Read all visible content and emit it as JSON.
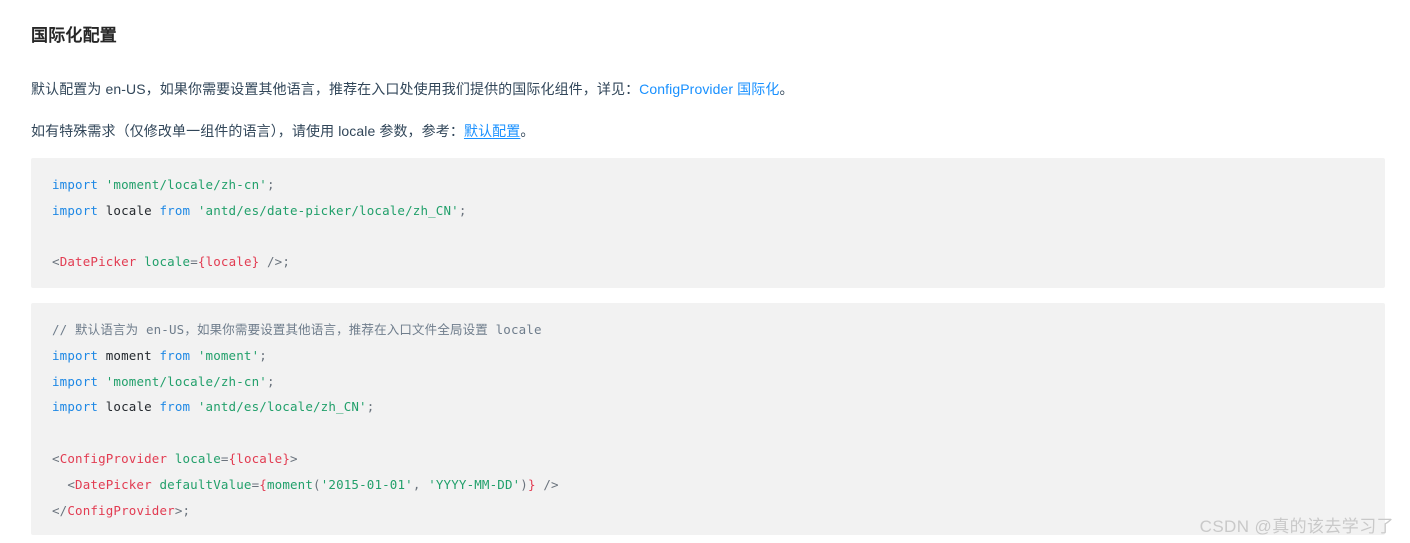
{
  "document": {
    "heading": "国际化配置",
    "paragraphs": [
      {
        "prefix": "默认配置为 en-US，如果你需要设置其他语言，推荐在入口处使用我们提供的国际化组件，详见：",
        "link": "ConfigProvider 国际化",
        "suffix": "。"
      },
      {
        "prefix": "如有特殊需求（仅修改单一组件的语言），请使用 locale 参数，参考：",
        "link": "默认配置",
        "suffix": "。"
      }
    ]
  },
  "code_blocks": [
    {
      "name": "datepicker-locale-snippet",
      "lines": [
        {
          "tokens": [
            {
              "t": "import",
              "c": "kw"
            },
            {
              "t": " ",
              "c": "plain"
            },
            {
              "t": "'moment/locale/zh-cn'",
              "c": "str"
            },
            {
              "t": ";",
              "c": "punct"
            }
          ]
        },
        {
          "tokens": [
            {
              "t": "import",
              "c": "kw"
            },
            {
              "t": " locale ",
              "c": "plain"
            },
            {
              "t": "from",
              "c": "kw"
            },
            {
              "t": " ",
              "c": "plain"
            },
            {
              "t": "'antd/es/date-picker/locale/zh_CN'",
              "c": "str"
            },
            {
              "t": ";",
              "c": "punct"
            }
          ]
        },
        {
          "tokens": [
            {
              "t": " ",
              "c": "plain"
            }
          ]
        },
        {
          "tokens": [
            {
              "t": "<",
              "c": "punct"
            },
            {
              "t": "DatePicker",
              "c": "tag"
            },
            {
              "t": " ",
              "c": "plain"
            },
            {
              "t": "locale",
              "c": "attr"
            },
            {
              "t": "=",
              "c": "punct"
            },
            {
              "t": "{locale}",
              "c": "brace"
            },
            {
              "t": " />",
              "c": "punct"
            },
            {
              "t": ";",
              "c": "punct"
            }
          ]
        }
      ]
    },
    {
      "name": "configprovider-locale-snippet",
      "lines": [
        {
          "tokens": [
            {
              "t": "// 默认语言为 en-US，如果你需要设置其他语言，推荐在入口文件全局设置 locale",
              "c": "comment"
            }
          ]
        },
        {
          "tokens": [
            {
              "t": "import",
              "c": "kw"
            },
            {
              "t": " moment ",
              "c": "plain"
            },
            {
              "t": "from",
              "c": "kw"
            },
            {
              "t": " ",
              "c": "plain"
            },
            {
              "t": "'moment'",
              "c": "str"
            },
            {
              "t": ";",
              "c": "punct"
            }
          ]
        },
        {
          "tokens": [
            {
              "t": "import",
              "c": "kw"
            },
            {
              "t": " ",
              "c": "plain"
            },
            {
              "t": "'moment/locale/zh-cn'",
              "c": "str"
            },
            {
              "t": ";",
              "c": "punct"
            }
          ]
        },
        {
          "tokens": [
            {
              "t": "import",
              "c": "kw"
            },
            {
              "t": " locale ",
              "c": "plain"
            },
            {
              "t": "from",
              "c": "kw"
            },
            {
              "t": " ",
              "c": "plain"
            },
            {
              "t": "'antd/es/locale/zh_CN'",
              "c": "str"
            },
            {
              "t": ";",
              "c": "punct"
            }
          ]
        },
        {
          "tokens": [
            {
              "t": " ",
              "c": "plain"
            }
          ]
        },
        {
          "tokens": [
            {
              "t": "<",
              "c": "punct"
            },
            {
              "t": "ConfigProvider",
              "c": "tag"
            },
            {
              "t": " ",
              "c": "plain"
            },
            {
              "t": "locale",
              "c": "attr"
            },
            {
              "t": "=",
              "c": "punct"
            },
            {
              "t": "{locale}",
              "c": "brace"
            },
            {
              "t": ">",
              "c": "punct"
            }
          ]
        },
        {
          "tokens": [
            {
              "t": "  <",
              "c": "punct"
            },
            {
              "t": "DatePicker",
              "c": "tag"
            },
            {
              "t": " ",
              "c": "plain"
            },
            {
              "t": "defaultValue",
              "c": "attr"
            },
            {
              "t": "=",
              "c": "punct"
            },
            {
              "t": "{",
              "c": "brace"
            },
            {
              "t": "moment",
              "c": "fn"
            },
            {
              "t": "(",
              "c": "punct"
            },
            {
              "t": "'2015-01-01'",
              "c": "str"
            },
            {
              "t": ", ",
              "c": "punct"
            },
            {
              "t": "'YYYY-MM-DD'",
              "c": "str"
            },
            {
              "t": ")",
              "c": "punct"
            },
            {
              "t": "}",
              "c": "brace"
            },
            {
              "t": " />",
              "c": "punct"
            }
          ]
        },
        {
          "tokens": [
            {
              "t": "</",
              "c": "punct"
            },
            {
              "t": "ConfigProvider",
              "c": "tag"
            },
            {
              "t": ">",
              "c": "punct"
            },
            {
              "t": ";",
              "c": "punct"
            }
          ]
        }
      ]
    }
  ],
  "watermark": {
    "text": "CSDN @真的该去学习了"
  },
  "colors": {
    "link": "#1890ff",
    "heading": "#262626",
    "body_text": "#314659",
    "code_background": "#f2f2f2",
    "keyword": "#1e88e5",
    "string": "#22a06b",
    "tag": "#e23c52",
    "comment": "#6f7d8c",
    "watermark": "#c9c9c9"
  }
}
